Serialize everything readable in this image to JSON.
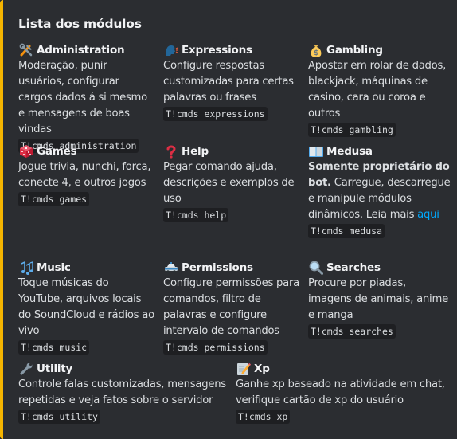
{
  "embed": {
    "accent_color": "#f5b400",
    "title": "Lista dos módulos",
    "fields": [
      {
        "icon": "hammer-and-wrench-icon",
        "name": "Administration",
        "value": "Moderação, punir usuários, configurar cargos dados á si mesmo e mensagens de boas vindas",
        "command": "T!cmds administration"
      },
      {
        "icon": "speaking-head-icon",
        "name": "Expressions",
        "value": "Configure respostas customizadas para certas palavras ou frases",
        "command": "T!cmds expressions"
      },
      {
        "icon": "money-bag-icon",
        "name": "Gambling",
        "value": "Apostar em rolar de dados, blackjack, máquinas de casino, cara ou coroa e outros",
        "command": "T!cmds gambling"
      },
      {
        "icon": "game-die-icon",
        "name": "Games",
        "value": "Jogue trivia, nunchi, forca, conecte 4, e outros jogos",
        "command": "T!cmds games"
      },
      {
        "icon": "question-mark-icon",
        "name": "Help",
        "value": "Pegar comando ajuda, descrições e exemplos de uso",
        "command": "T!cmds help"
      },
      {
        "icon": "open-book-icon",
        "name": "Medusa",
        "value_bold": "Somente proprietário do bot.",
        "value": " Carregue, descarregue e manipule módulos dinâmicos. Leia mais ",
        "link_text": "aqui",
        "command": "T!cmds medusa"
      },
      {
        "icon": "musical-notes-icon",
        "name": "Music",
        "value": "Toque músicas do YouTube, arquivos locais do SoundCloud e rádios ao vivo",
        "command": "T!cmds music"
      },
      {
        "icon": "police-car-icon",
        "name": "Permissions",
        "value": "Configure permissões para comandos, filtro de palavras e configure intervalo de comandos",
        "command": "T!cmds permissions"
      },
      {
        "icon": "magnifying-glass-icon",
        "name": "Searches",
        "value": "Procure por piadas, imagens de animais, anime e manga",
        "command": "T!cmds searches"
      },
      {
        "icon": "wrench-icon",
        "name": "Utility",
        "value": "Controle falas customizadas, mensagens repetidas e veja fatos sobre o servidor",
        "command": "T!cmds utility"
      },
      {
        "icon": "memo-icon",
        "name": "Xp",
        "value": "Ganhe xp baseado na atividade em chat, verifique cartão de xp do usuário",
        "command": "T!cmds xp"
      }
    ]
  }
}
